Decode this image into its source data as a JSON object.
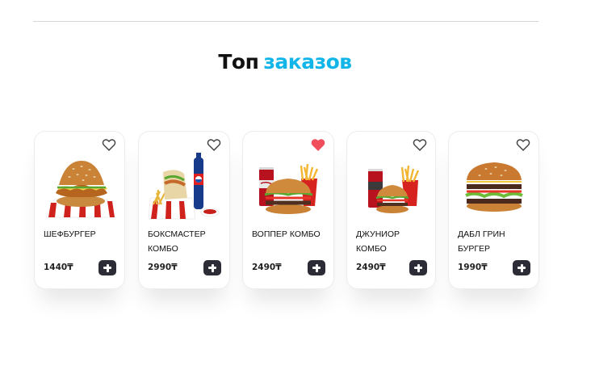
{
  "section": {
    "title_part1": "Топ",
    "title_part2": "заказов"
  },
  "colors": {
    "accent": "#12b5e8",
    "heart_active": "#f04e5b",
    "add_button": "#2b2c36"
  },
  "products": [
    {
      "name": "ШЕФБУРГЕР",
      "price": "1440₸",
      "favorite": false,
      "image_icon": "chef-burger-image"
    },
    {
      "name": "БОКСМАСТЕР КОМБО",
      "price": "2990₸",
      "favorite": false,
      "image_icon": "boxmaster-combo-image"
    },
    {
      "name": "ВОППЕР КОМБО",
      "price": "2490₸",
      "favorite": true,
      "image_icon": "whopper-combo-image"
    },
    {
      "name": "ДЖУНИОР КОМБО",
      "price": "2490₸",
      "favorite": false,
      "image_icon": "junior-combo-image"
    },
    {
      "name": "ДАБЛ ГРИН БУРГЕР",
      "price": "1990₸",
      "favorite": false,
      "image_icon": "double-green-burger-image"
    }
  ],
  "icons": {
    "favorite": "heart-icon",
    "add_to_cart": "plus-icon"
  }
}
